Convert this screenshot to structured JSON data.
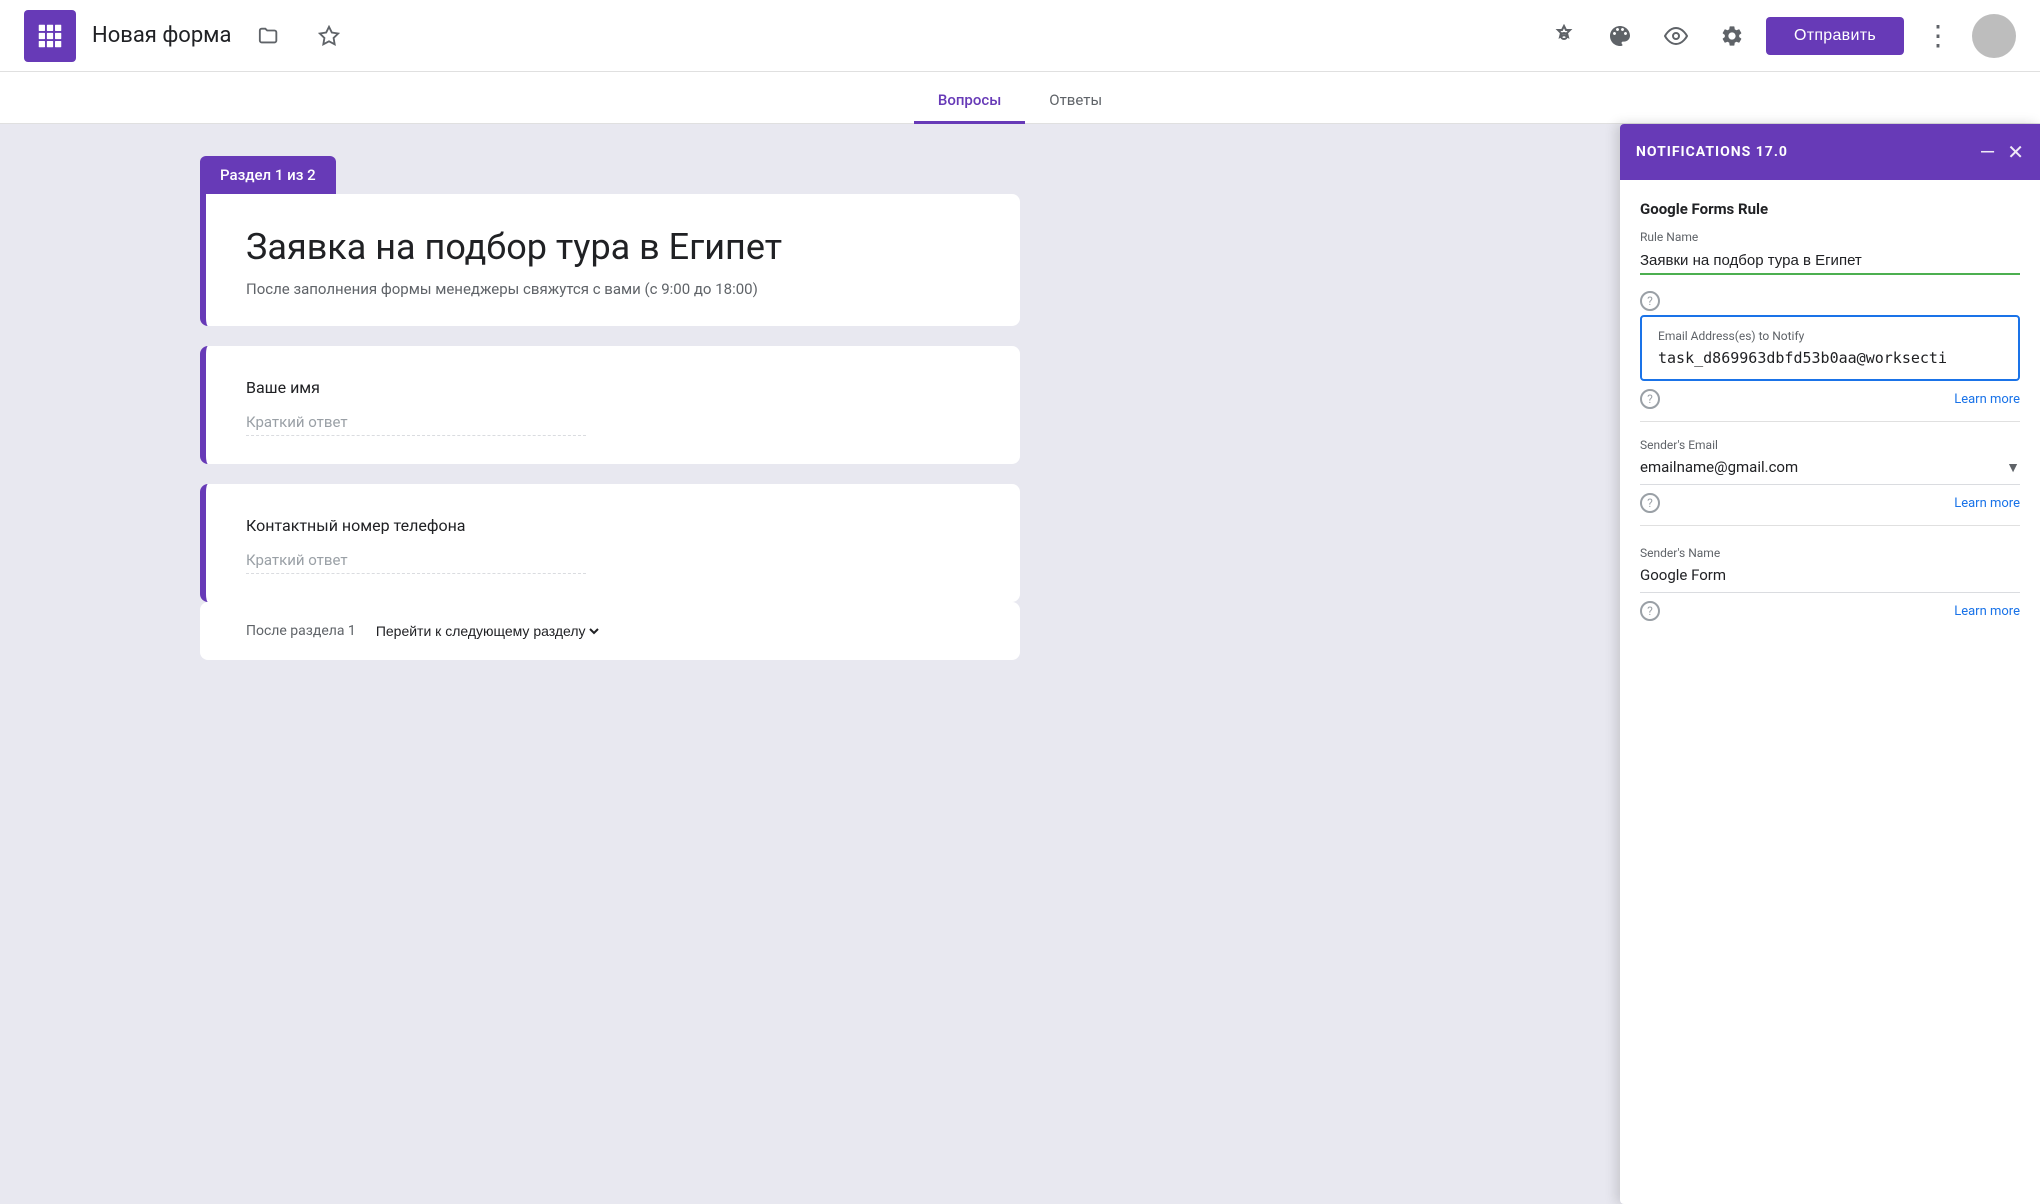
{
  "topbar": {
    "app_name": "Новая форма",
    "send_button_label": "Отправить",
    "icons": {
      "addon": "🧩",
      "palette": "🎨",
      "preview": "👁",
      "settings": "⚙️",
      "more": "⋮"
    }
  },
  "tabs": [
    {
      "label": "Вопросы",
      "active": true
    },
    {
      "label": "Ответы",
      "active": false
    }
  ],
  "form": {
    "section_label": "Раздел 1 из 2",
    "title": "Заявка на подбор тура в Египет",
    "description": "После заполнения формы менеджеры свяжутся с вами (с 9:00 до 18:00)",
    "fields": [
      {
        "label": "Ваше имя",
        "placeholder": "Краткий ответ"
      },
      {
        "label": "Контактный номер телефона",
        "placeholder": "Краткий ответ"
      }
    ],
    "after_section_label": "После раздела 1",
    "after_section_value": "Перейти к следующему разделу"
  },
  "notifications_panel": {
    "title": "NOTIFICATIONS 17.0",
    "minimize_icon": "—",
    "close_icon": "✕",
    "section_title": "Google Forms Rule",
    "rule_name_label": "Rule Name",
    "rule_name_value": "Заявки на подбор тура в Египет",
    "email_notify_label": "Email Address(es) to Notify",
    "email_notify_value": "task_d869963dbfd53b0aa@worksecti",
    "learn_more_1": "Learn more",
    "sender_email_label": "Sender's Email",
    "sender_email_value": "emailname@gmail.com",
    "learn_more_2": "Learn more",
    "sender_name_label": "Sender's Name",
    "sender_name_value": "Google Form",
    "learn_more_3": "Learn more"
  }
}
